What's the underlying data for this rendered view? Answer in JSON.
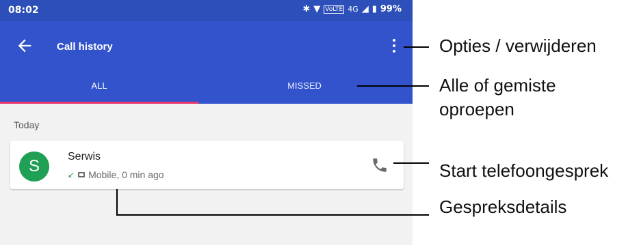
{
  "status_bar": {
    "time": "08:02",
    "network": "4G",
    "battery": "99%"
  },
  "header": {
    "title": "Call history"
  },
  "tabs": [
    {
      "label": "ALL",
      "selected": true
    },
    {
      "label": "MISSED",
      "selected": false
    }
  ],
  "section_label": "Today",
  "calls": [
    {
      "name": "Serwis",
      "initial": "S",
      "detail": "Mobile, 0 min ago",
      "avatar_color": "#1fa055"
    }
  ],
  "annotations": [
    "Opties / verwijderen",
    "Alle of gemiste",
    "oproepen",
    "Start telefoongesprek",
    "Gespreksdetails"
  ],
  "colors": {
    "appbar": "#3253cc",
    "tab_indicator": "#e9336a"
  }
}
